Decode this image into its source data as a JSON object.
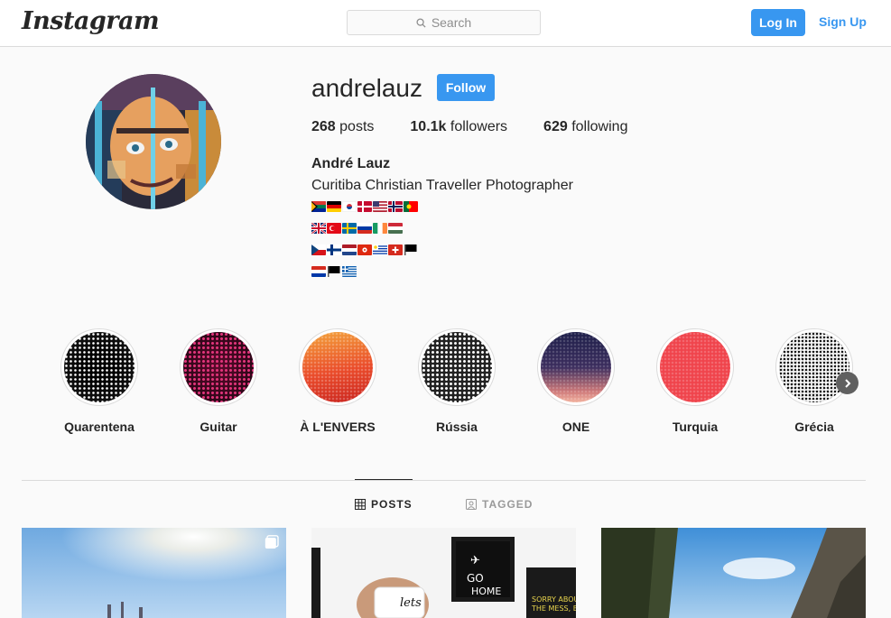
{
  "topbar": {
    "logo": "Instagram",
    "search_placeholder": "Search",
    "login_label": "Log In",
    "signup_label": "Sign Up",
    "accent_color": "#3897f0"
  },
  "profile": {
    "username": "andrelauz",
    "follow_label": "Follow",
    "stats": {
      "posts_count": "268",
      "posts_label": "posts",
      "followers_count": "10.1k",
      "followers_label": "followers",
      "following_count": "629",
      "following_label": "following"
    },
    "full_name": "André Lauz",
    "bio": "Curitiba Christian Traveller Photographer",
    "flag_rows": [
      [
        "south-africa",
        "germany",
        "south-korea",
        "denmark",
        "united-states",
        "norway",
        "portugal"
      ],
      [
        "united-kingdom",
        "turkey",
        "sweden",
        "russia",
        "ireland",
        "hungary"
      ],
      [
        "czech-republic",
        "finland",
        "netherlands",
        "hong-kong",
        "uruguay",
        "switzerland",
        "black-flag"
      ],
      [
        "paraguay",
        "black-flag",
        "greece"
      ]
    ]
  },
  "highlights": [
    {
      "label": "Quarentena"
    },
    {
      "label": "Guitar"
    },
    {
      "label": "À L'ENVERS"
    },
    {
      "label": "Rússia"
    },
    {
      "label": "ONE"
    },
    {
      "label": "Turquia"
    },
    {
      "label": "Grécia"
    }
  ],
  "tabs": {
    "posts_label": "POSTS",
    "tagged_label": "TAGGED"
  },
  "icons": {
    "search": "search-icon",
    "posts_tab": "grid-icon",
    "tagged_tab": "tag-user-icon",
    "next": "chevron-right-icon",
    "multi_post": "carousel-icon"
  }
}
